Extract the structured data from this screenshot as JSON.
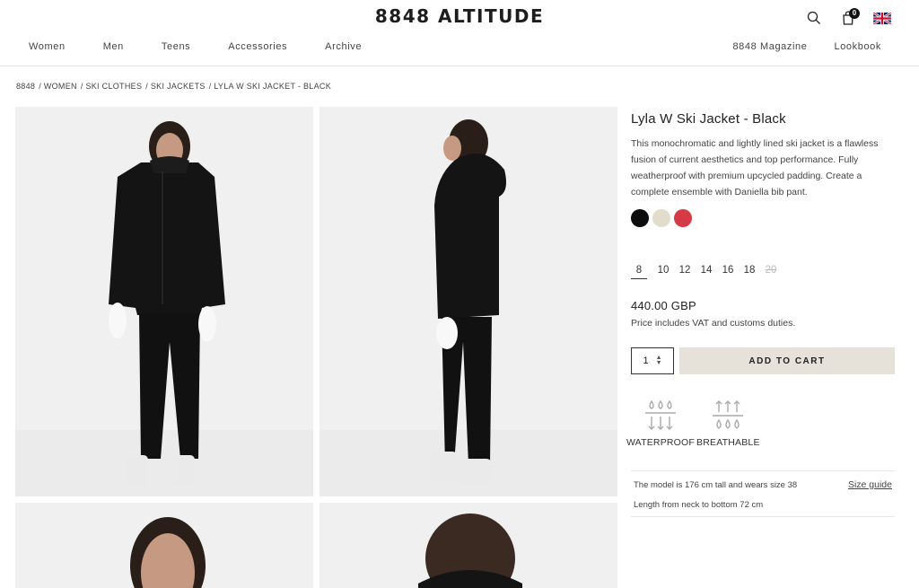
{
  "brand": "8848 ALTITUDE",
  "header": {
    "cart_count": "0",
    "nav_left": [
      "Women",
      "Men",
      "Teens",
      "Accessories",
      "Archive"
    ],
    "nav_right": [
      "8848 Magazine",
      "Lookbook"
    ],
    "icons": [
      "search-icon",
      "cart-icon",
      "uk-flag-icon"
    ]
  },
  "breadcrumb": [
    "8848",
    "/ WOMEN",
    "/ SKI CLOTHES",
    "/ SKI JACKETS",
    "/ LYLA W SKI JACKET - BLACK"
  ],
  "product": {
    "title": "Lyla W Ski Jacket - Black",
    "description": "This monochromatic and lightly lined ski jacket is a flawless fusion of current aesthetics and top performance. Fully weatherproof with premium upcycled padding. Create a complete ensemble with Daniella bib pant.",
    "colors": [
      "#0d0d0d",
      "#e2dccd",
      "#d63a44"
    ],
    "sizes": [
      {
        "label": "8",
        "selected": true,
        "available": true
      },
      {
        "label": "10",
        "selected": false,
        "available": true
      },
      {
        "label": "12",
        "selected": false,
        "available": true
      },
      {
        "label": "14",
        "selected": false,
        "available": true
      },
      {
        "label": "16",
        "selected": false,
        "available": true
      },
      {
        "label": "18",
        "selected": false,
        "available": true
      },
      {
        "label": "20",
        "selected": false,
        "available": false
      }
    ],
    "price": "440.00 GBP",
    "vat_note": "Price includes VAT and customs duties.",
    "quantity": "1",
    "add_to_cart": "ADD TO CART",
    "features": [
      {
        "label": "WATERPROOF",
        "icon": "waterproof-icon"
      },
      {
        "label": "BREATHABLE",
        "icon": "breathable-icon"
      }
    ],
    "model_info": "The model is 176 cm tall and wears size 38",
    "length_info": "Length from neck to bottom 72 cm",
    "size_guide": "Size guide"
  }
}
